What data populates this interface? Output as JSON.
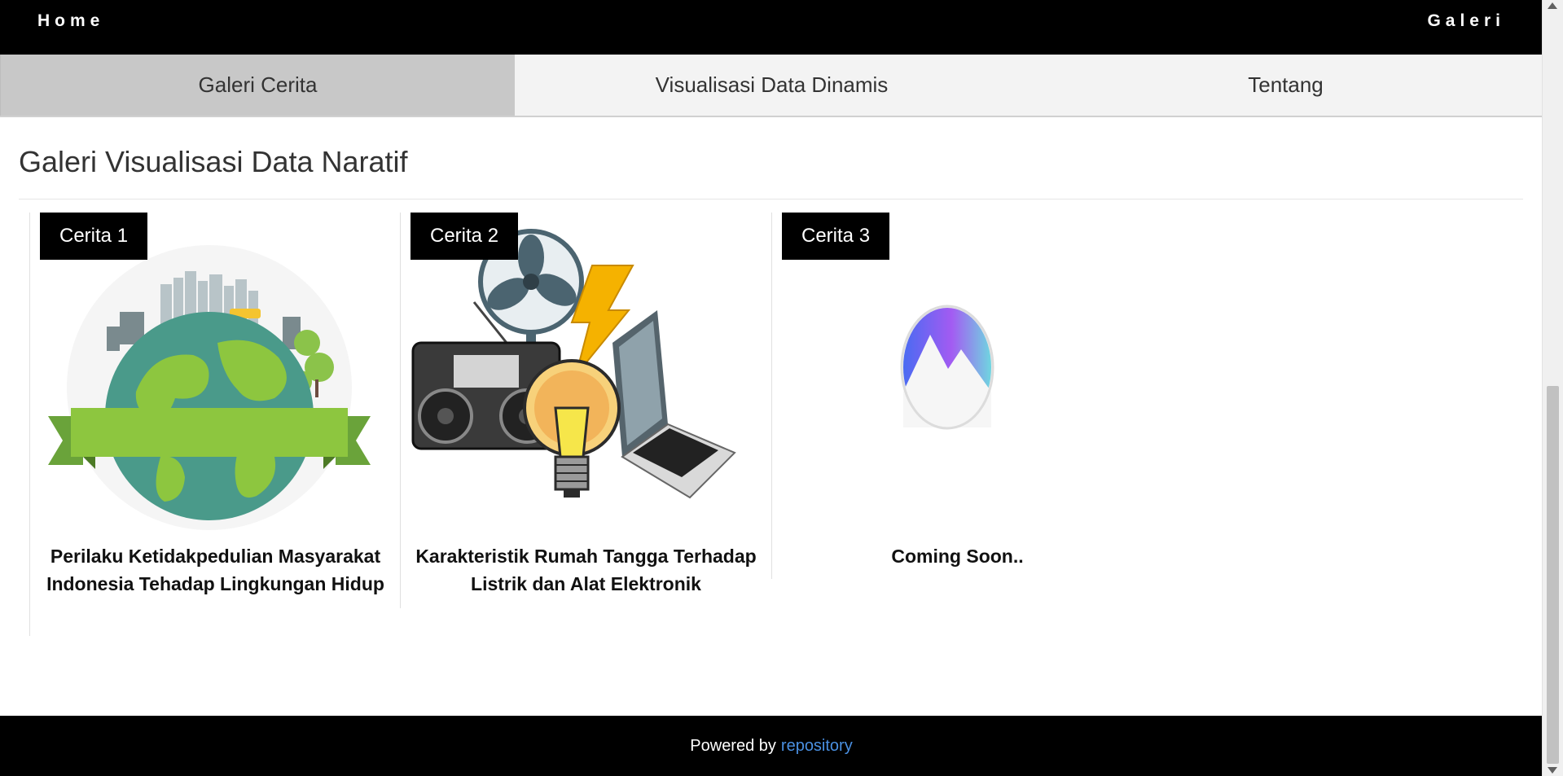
{
  "nav": {
    "home": "Home",
    "galeri": "Galeri"
  },
  "tabs": [
    {
      "label": "Galeri Cerita",
      "active": true
    },
    {
      "label": "Visualisasi Data Dinamis",
      "active": false
    },
    {
      "label": "Tentang",
      "active": false
    }
  ],
  "section_title": "Galeri Visualisasi Data Naratif",
  "cards": [
    {
      "badge": "Cerita 1",
      "title": "Perilaku Ketidakpedulian Masyarakat Indonesia Tehadap Lingkungan Hidup",
      "image": "earth-environment-illustration"
    },
    {
      "badge": "Cerita 2",
      "title": "Karakteristik Rumah Tangga Terhadap Listrik dan Alat Elektronik",
      "image": "household-electronics-illustration"
    },
    {
      "badge": "Cerita 3",
      "title": "Coming Soon..",
      "image": "mountain-logo-placeholder"
    }
  ],
  "footer": {
    "text": "Powered by",
    "link": "repository"
  },
  "colors": {
    "nav_bg": "#000000",
    "tab_bg": "#f3f3f3",
    "tab_active": "#c8c8c8",
    "link": "#4a90e2"
  }
}
